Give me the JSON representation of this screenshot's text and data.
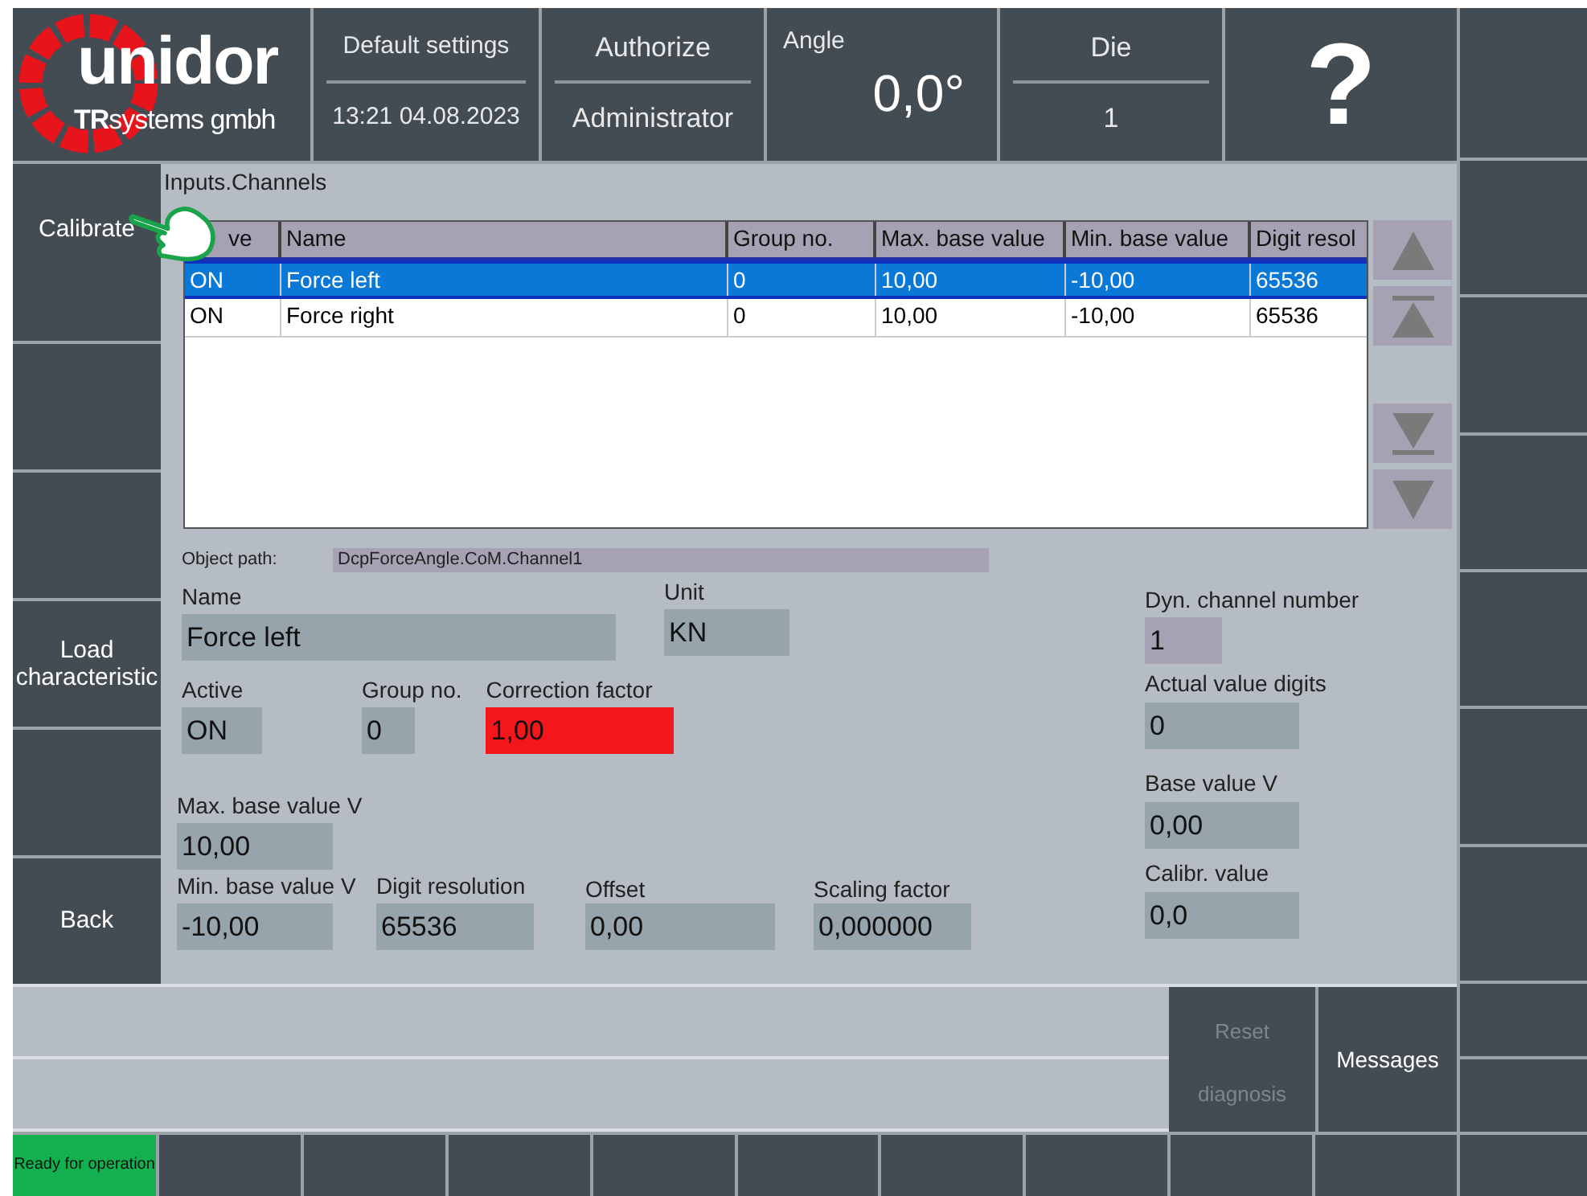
{
  "header": {
    "logo": {
      "wordmark": "unidor",
      "tagline": "**TR**systems gmbh"
    },
    "settings": {
      "top": "Default settings",
      "bottom": "13:21 04.08.2023"
    },
    "user": {
      "top": "Authorize",
      "bottom": "Administrator"
    },
    "angle": {
      "label": "Angle",
      "value": "0,0°"
    },
    "die": {
      "label": "Die",
      "value": "1"
    },
    "help": "?"
  },
  "left_buttons": [
    {
      "kind": "text",
      "label": "Calibrate"
    },
    {
      "kind": "blank"
    },
    {
      "kind": "blank"
    },
    {
      "kind": "text",
      "label": "Load characteristic"
    },
    {
      "kind": "blank"
    },
    {
      "kind": "text",
      "label": "Back"
    }
  ],
  "panel_title": "Inputs.Channels",
  "table": {
    "columns": [
      "ve",
      "Name",
      "Group no.",
      "Max. base value",
      "Min. base value",
      "Digit resol"
    ],
    "rows": [
      {
        "selected": true,
        "cells": [
          "ON",
          "Force left",
          "0",
          "10,00",
          "-10,00",
          "65536"
        ]
      },
      {
        "selected": false,
        "cells": [
          "ON",
          "Force right",
          "0",
          "10,00",
          "-10,00",
          "65536"
        ]
      }
    ]
  },
  "object_path": {
    "label": "Object path:",
    "value": "DcpForceAngle.CoM.Channel1"
  },
  "form_rows": [
    [
      {
        "label": "Name",
        "value": "Force left",
        "kind": "normal"
      },
      {
        "label": "Unit",
        "value": "KN",
        "kind": "normal"
      }
    ],
    [
      {
        "label": "Active",
        "value": "ON",
        "kind": "normal"
      },
      {
        "label": "Group no.",
        "value": "0",
        "kind": "normal"
      },
      {
        "label": "Correction factor",
        "value": "1,00",
        "kind": "alert"
      }
    ],
    [
      {
        "label": "Max. base value V",
        "value": "10,00",
        "kind": "normal"
      }
    ],
    [
      {
        "label": "Min. base value V",
        "value": "-10,00",
        "kind": "normal"
      },
      {
        "label": "Digit resolution",
        "value": "65536",
        "kind": "normal"
      },
      {
        "label": "Offset",
        "value": "0,00",
        "kind": "normal"
      },
      {
        "label": "Scaling factor",
        "value": "0,000000",
        "kind": "normal"
      }
    ]
  ],
  "right_fields": [
    {
      "label": "Dyn. channel number",
      "value": "1",
      "kind": "highlight"
    },
    {
      "label": "Actual value digits",
      "value": "0",
      "kind": "normal"
    },
    {
      "label": "Base value V",
      "value": "0,00",
      "kind": "normal"
    },
    {
      "label": "Calibr. value",
      "value": "0,0",
      "kind": "normal"
    }
  ],
  "messages": {
    "reset": "Reset diagnosis",
    "reset_disabled": true,
    "messages": "Messages"
  },
  "status": {
    "label": "Ready for operation"
  }
}
